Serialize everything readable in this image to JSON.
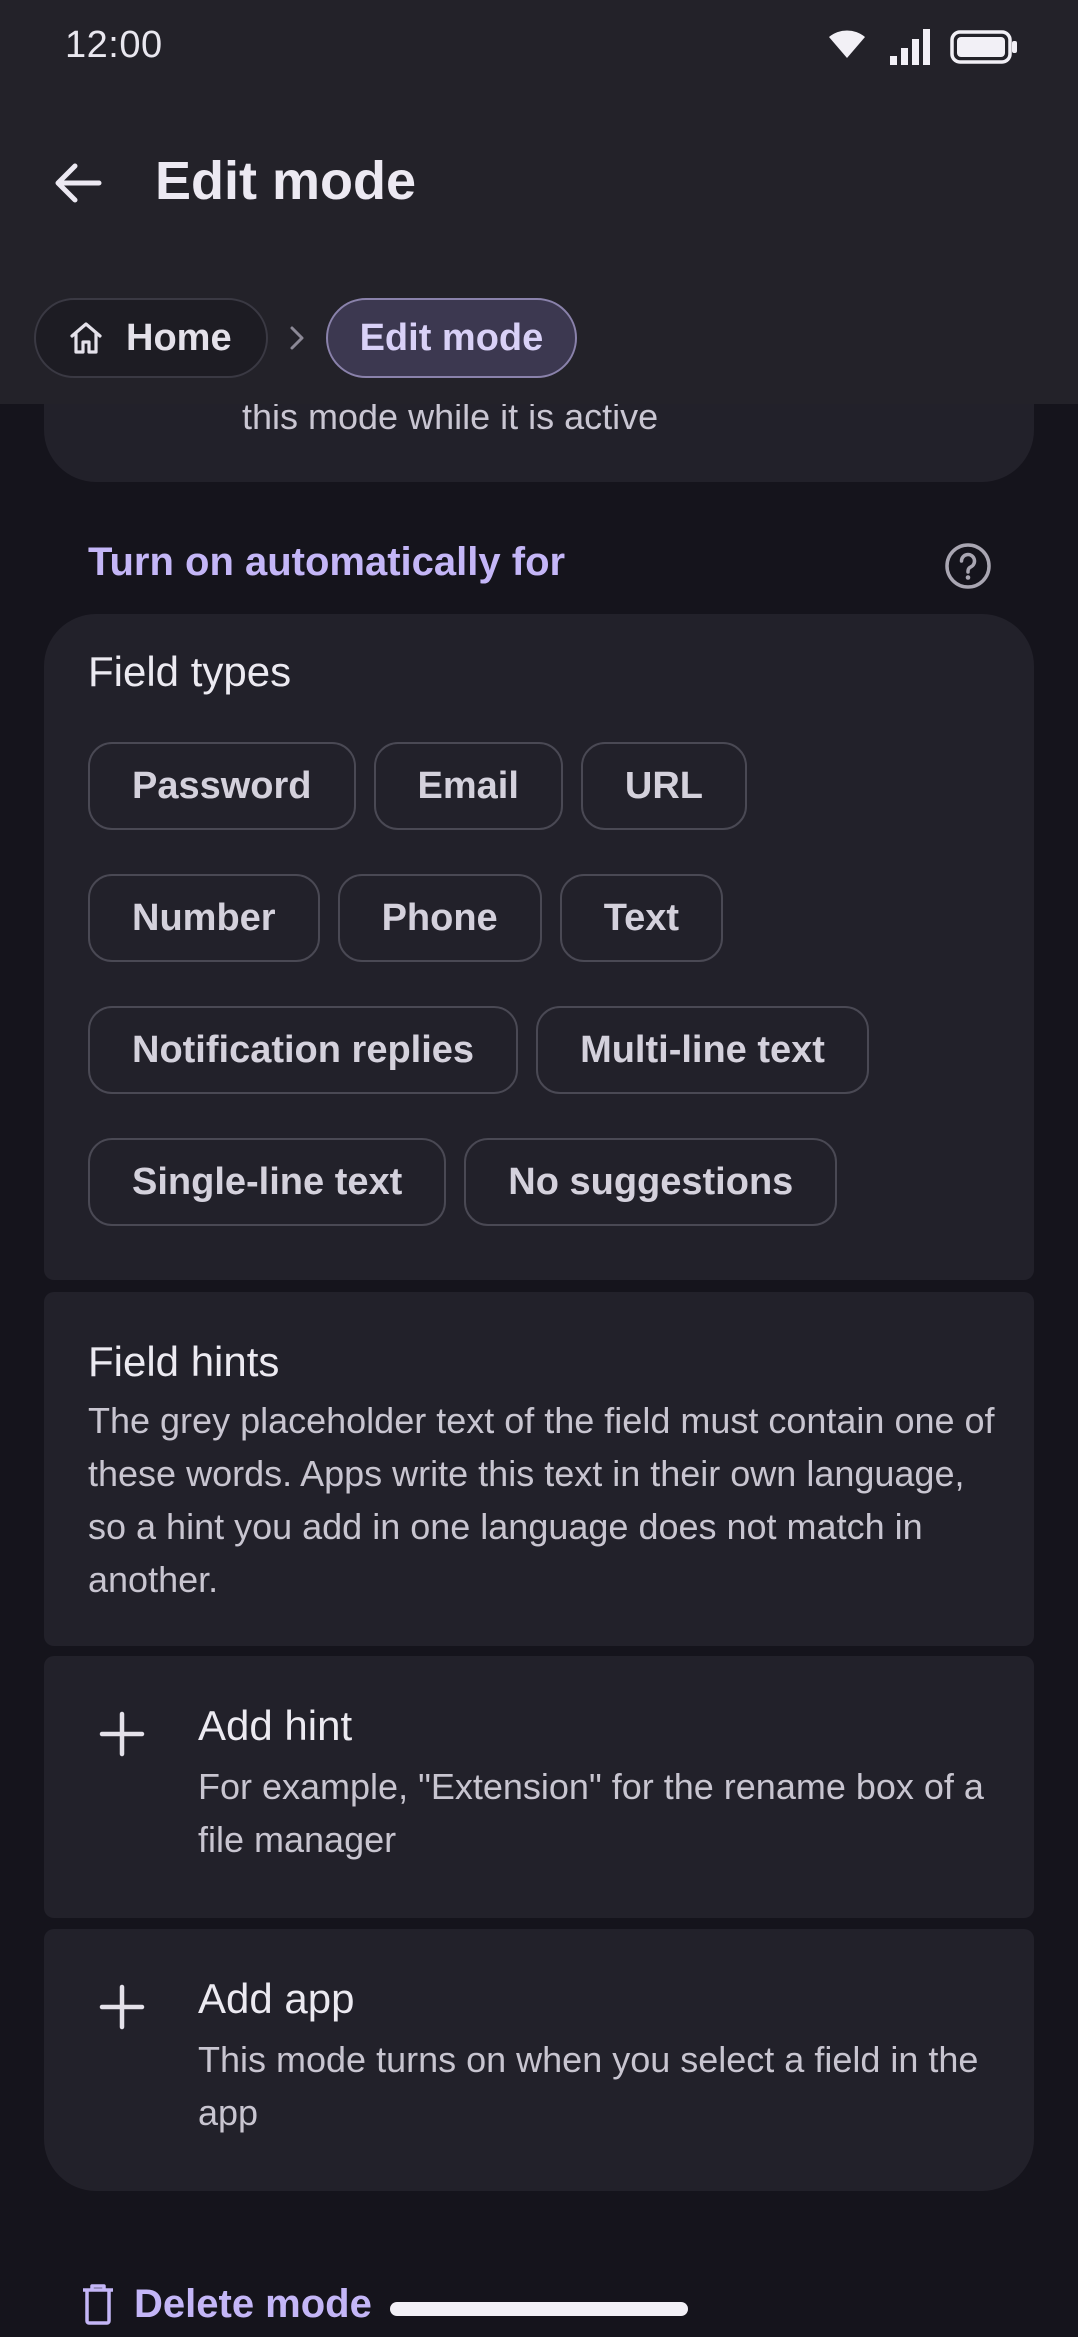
{
  "status_bar": {
    "time": "12:00",
    "icons": [
      "wifi-icon",
      "signal-icon",
      "battery-icon"
    ]
  },
  "app_bar": {
    "title": "Edit mode",
    "back_icon": "arrow-back-icon"
  },
  "breadcrumb": {
    "home_label": "Home",
    "home_icon": "home-icon",
    "separator_icon": "chevron-right-icon",
    "current_label": "Edit mode"
  },
  "top_card": {
    "text": "this mode while it is active"
  },
  "auto_section": {
    "header": "Turn on automatically for",
    "help_icon": "help-icon"
  },
  "field_types": {
    "title": "Field types",
    "rows": [
      [
        "Password",
        "Email",
        "URL"
      ],
      [
        "Number",
        "Phone",
        "Text"
      ],
      [
        "Notification replies",
        "Multi-line text"
      ],
      [
        "Single-line text",
        "No suggestions"
      ]
    ]
  },
  "field_hints": {
    "title": "Field hints",
    "description": "The grey placeholder text of the field must contain one of these words. Apps write this text in their own language, so a hint you add in one language does not match in another."
  },
  "add_hint": {
    "title": "Add hint",
    "description": "For example, \"Extension\" for the rename box of a file manager",
    "icon": "plus-icon"
  },
  "add_app": {
    "title": "Add app",
    "description": "This mode turns on when you select a field in the app",
    "icon": "plus-icon"
  },
  "delete": {
    "label": "Delete mode",
    "icon": "trash-icon"
  },
  "colors": {
    "background": "#15141c",
    "surface": "#22212a",
    "app_bar": "#232229",
    "accent": "#c4b6f7"
  }
}
